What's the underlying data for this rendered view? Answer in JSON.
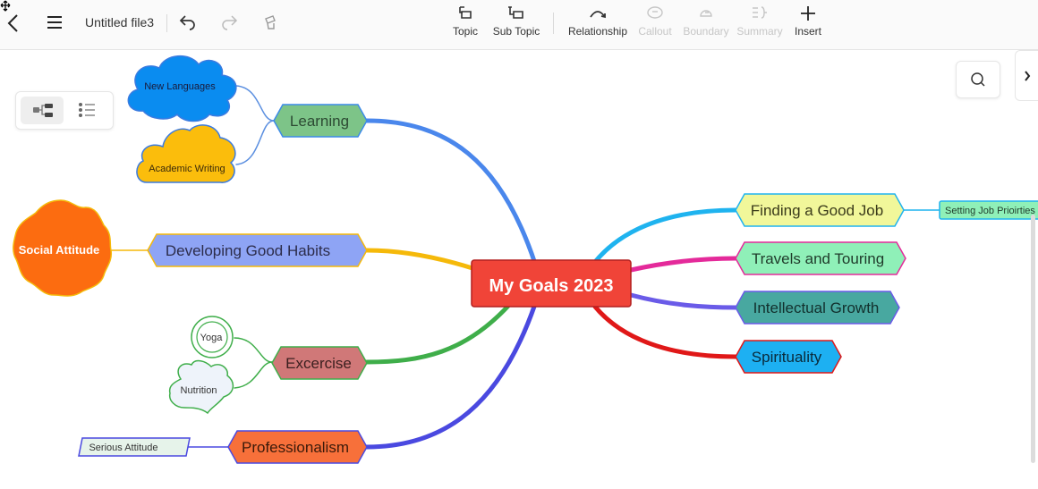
{
  "toolbar": {
    "file_title": "Untitled file3",
    "tools": {
      "topic": "Topic",
      "subtopic": "Sub Topic",
      "relationship": "Relationship",
      "callout": "Callout",
      "boundary": "Boundary",
      "summary": "Summary",
      "insert": "Insert"
    }
  },
  "mindmap": {
    "central": "My Goals 2023",
    "left_topics": {
      "learning": "Learning",
      "habits": "Developing Good Habits",
      "exercise": "Excercise",
      "professionalism": "Professionalism"
    },
    "left_subtopics": {
      "new_languages": "New Languages",
      "academic_writing": "Academic Writing",
      "social_attitude": "Social Attitude",
      "yoga": "Yoga",
      "nutrition": "Nutrition",
      "serious_attitude": "Serious Attitude"
    },
    "right_topics": {
      "good_job": "Finding a Good Job",
      "travels": "Travels and Touring",
      "intellectual": "Intellectual Growth",
      "spirituality": "Spirituality"
    },
    "right_subtopics": {
      "job_priorities": "Setting Job Prioirties"
    }
  },
  "colors": {
    "central_fill": "#f04438",
    "learning_fill": "#7dc488",
    "habits_fill": "#8ea4f5",
    "exercise_fill": "#d07878",
    "professionalism_fill": "#f7703a",
    "good_job_fill": "#f1f79a",
    "travels_fill": "#8ff0b8",
    "intellectual_fill": "#48a8a0",
    "spirituality_fill": "#1db0f2",
    "new_languages_fill": "#0a8cf0",
    "academic_writing_fill": "#fbbd0c",
    "social_attitude_fill": "#fc6c10"
  },
  "icons": [
    "back-icon",
    "menu-icon",
    "undo-icon",
    "redo-icon",
    "format-painter-icon",
    "topic-icon",
    "subtopic-icon",
    "relationship-icon",
    "callout-icon",
    "boundary-icon",
    "summary-icon",
    "plus-icon",
    "mindmap-view-icon",
    "outline-view-icon",
    "search-icon",
    "chevron-right-icon"
  ]
}
